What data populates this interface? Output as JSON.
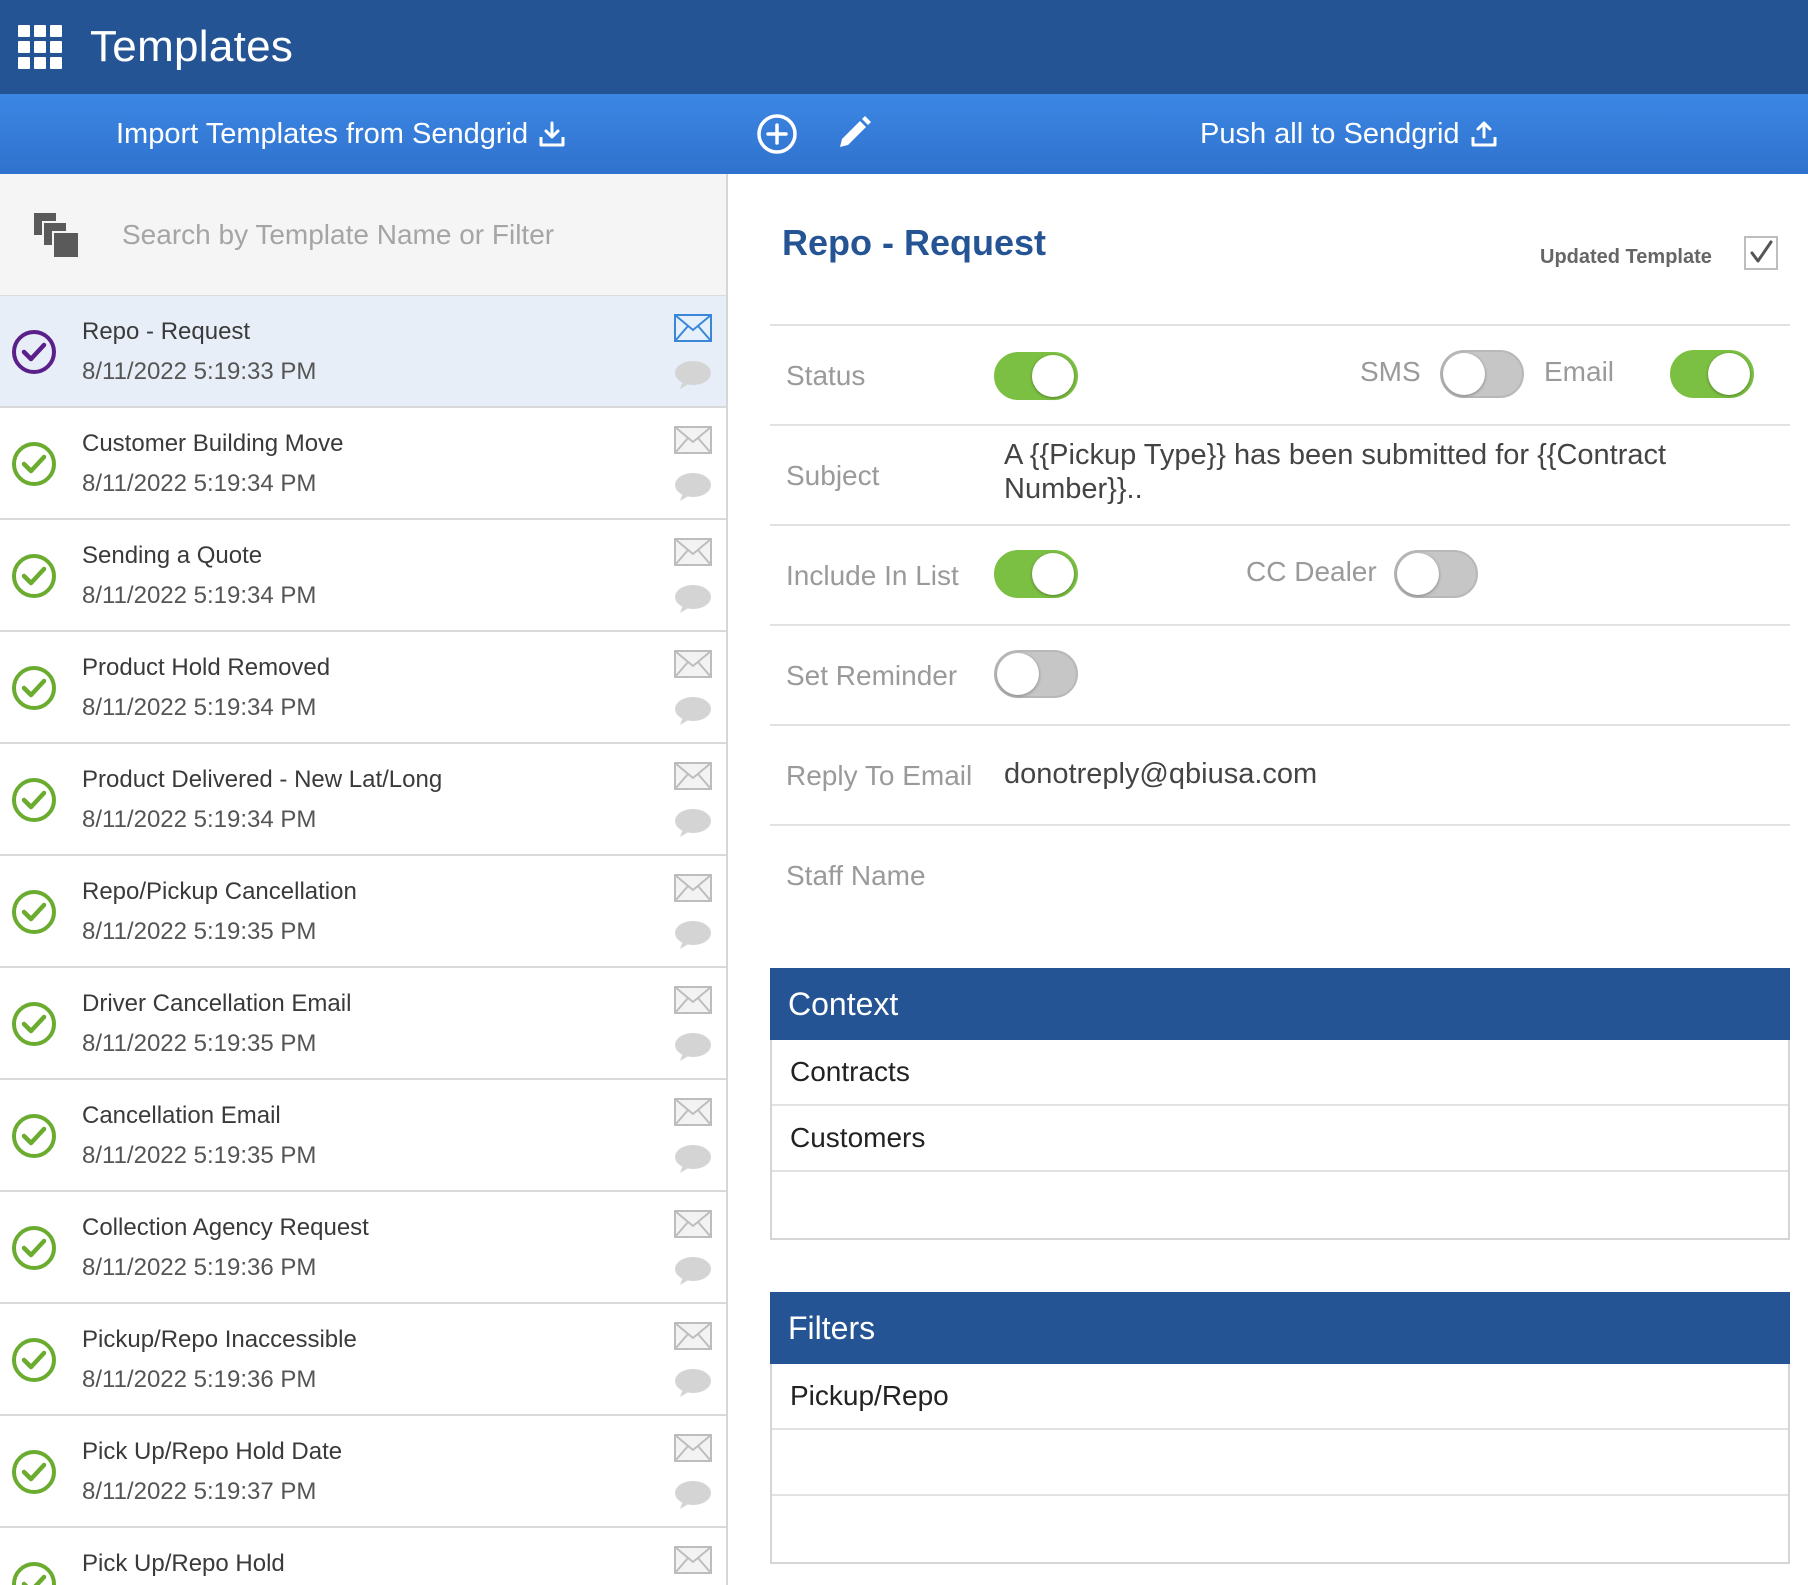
{
  "app": {
    "title": "Templates"
  },
  "toolbar": {
    "import_label": "Import Templates from Sendgrid",
    "push_label": "Push all to Sendgrid"
  },
  "search": {
    "placeholder": "Search by Template Name or Filter"
  },
  "templates": [
    {
      "name": "Repo - Request",
      "date": "8/11/2022 5:19:33 PM",
      "selected": true
    },
    {
      "name": "Customer Building Move",
      "date": "8/11/2022 5:19:34 PM"
    },
    {
      "name": "Sending a Quote",
      "date": "8/11/2022 5:19:34 PM"
    },
    {
      "name": "Product Hold Removed",
      "date": "8/11/2022 5:19:34 PM"
    },
    {
      "name": "Product Delivered - New Lat/Long",
      "date": "8/11/2022 5:19:34 PM"
    },
    {
      "name": "Repo/Pickup Cancellation",
      "date": "8/11/2022 5:19:35 PM"
    },
    {
      "name": "Driver Cancellation Email",
      "date": "8/11/2022 5:19:35 PM"
    },
    {
      "name": "Cancellation Email",
      "date": "8/11/2022 5:19:35 PM"
    },
    {
      "name": "Collection Agency Request",
      "date": "8/11/2022 5:19:36 PM"
    },
    {
      "name": "Pickup/Repo Inaccessible",
      "date": "8/11/2022 5:19:36 PM"
    },
    {
      "name": "Pick Up/Repo Hold Date",
      "date": "8/11/2022 5:19:37 PM"
    },
    {
      "name": "Pick Up/Repo Hold",
      "date": ""
    }
  ],
  "detail": {
    "title": "Repo - Request",
    "updated_label": "Updated Template",
    "status_label": "Status",
    "status_on": true,
    "sms_label": "SMS",
    "sms_on": false,
    "email_label": "Email",
    "email_on": true,
    "subject_label": "Subject",
    "subject_value": "A {{Pickup Type}} has been submitted for {{Contract Number}}..",
    "include_label": "Include In List",
    "include_on": true,
    "cc_label": "CC Dealer",
    "cc_on": false,
    "reminder_label": "Set Reminder",
    "reminder_on": false,
    "reply_label": "Reply To Email",
    "reply_value": "donotreply@qbiusa.com",
    "staff_label": "Staff Name"
  },
  "context": {
    "title": "Context",
    "items": [
      "Contracts",
      "Customers",
      ""
    ]
  },
  "filters": {
    "title": "Filters",
    "items": [
      "Pickup/Repo",
      "",
      ""
    ]
  },
  "colors": {
    "header": "#255495",
    "toolbar": "#3379d6",
    "toggle_on": "#7cc043",
    "toggle_off": "#c6c6c6",
    "check_selected": "#5b1f8a",
    "check_normal": "#6aac2f"
  }
}
